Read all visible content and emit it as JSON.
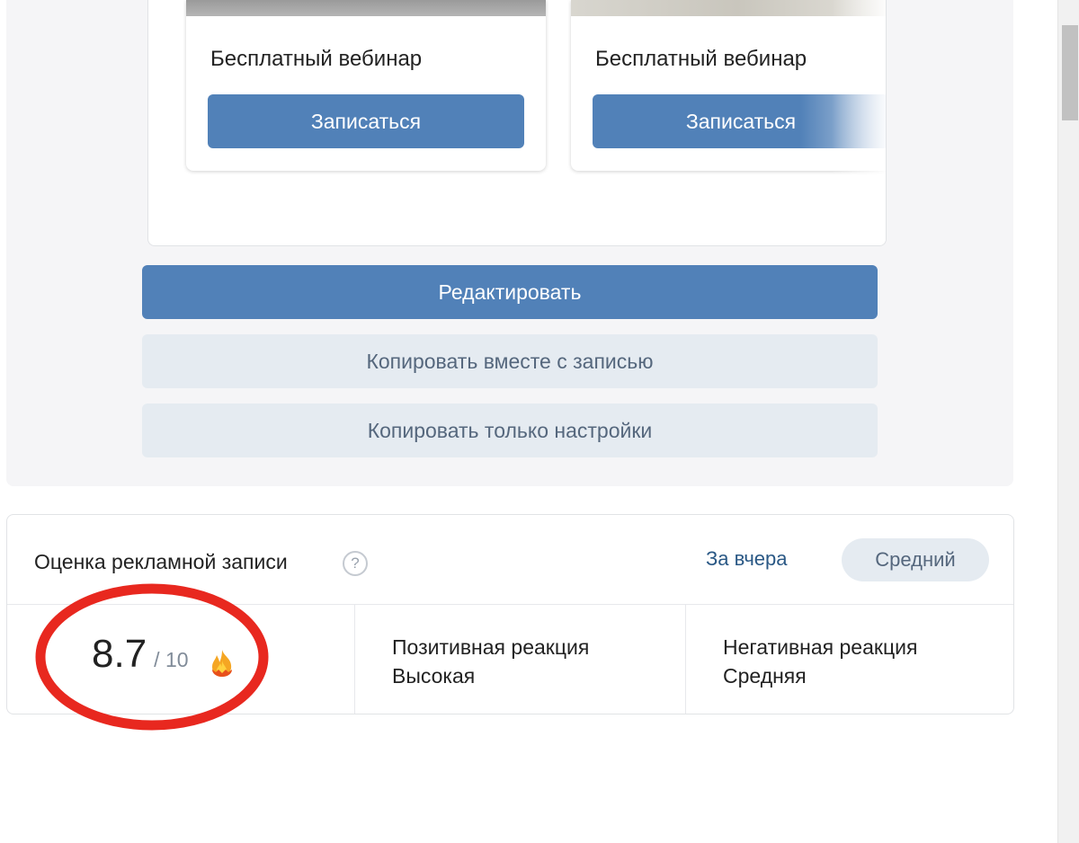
{
  "ad_preview": {
    "cards": [
      {
        "title": "Бесплатный вебинар",
        "button_label": "Записаться"
      },
      {
        "title": "Бесплатный вебинар",
        "button_label": "Записаться"
      }
    ]
  },
  "actions": {
    "edit_label": "Редактировать",
    "copy_with_post_label": "Копировать вместе с записью",
    "copy_settings_label": "Копировать только настройки"
  },
  "rating": {
    "title": "Оценка рекламной записи",
    "help_symbol": "?",
    "period_label": "За вчера",
    "level_label": "Средний",
    "score": "8.7",
    "score_max": "/ 10",
    "score_icon": "fire-icon",
    "positive": {
      "label": "Позитивная реакция",
      "value": "Высокая"
    },
    "negative": {
      "label": "Негативная реакция",
      "value": "Средняя"
    }
  },
  "colors": {
    "primary_button": "#5181b8",
    "secondary_button": "#e5ebf1",
    "link": "#2a5885",
    "highlight": "#e8281f"
  }
}
